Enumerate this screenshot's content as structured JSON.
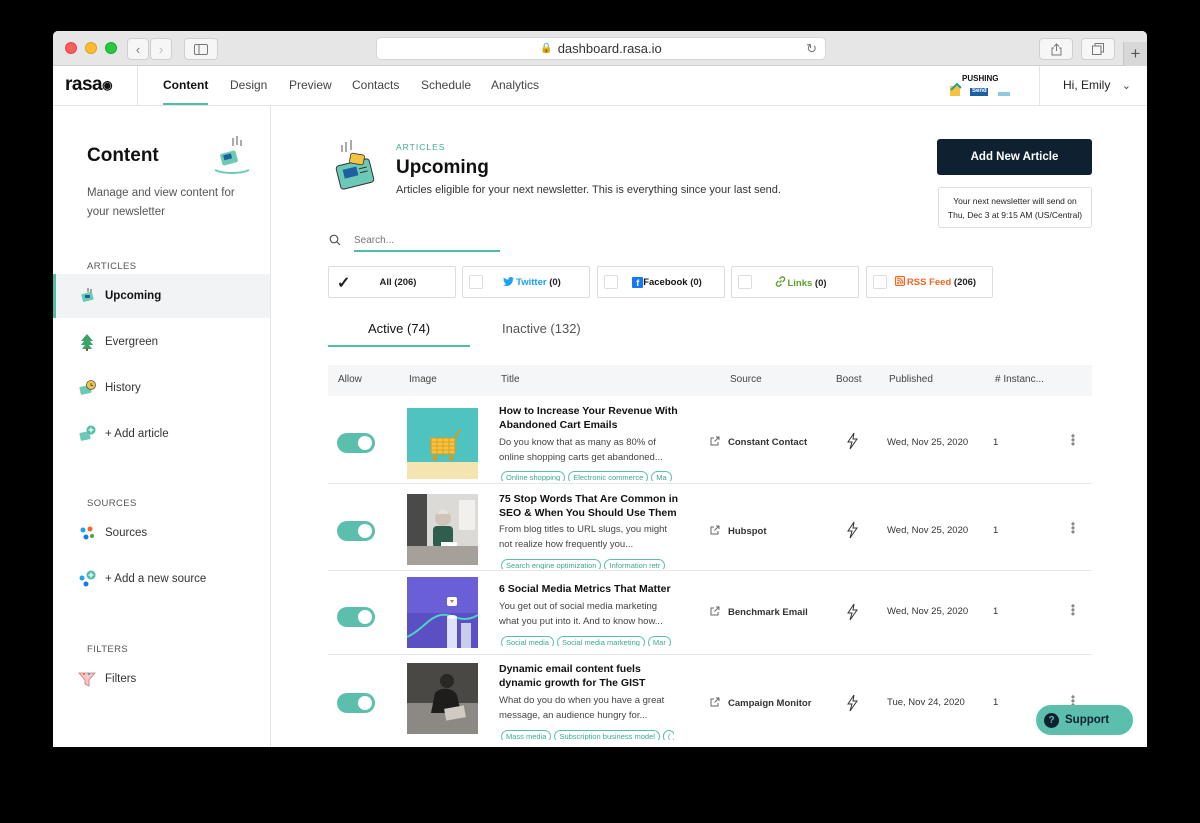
{
  "browser": {
    "url": "dashboard.rasa.io"
  },
  "nav": {
    "logo": "rasa",
    "tabs": [
      "Content",
      "Design",
      "Preview",
      "Contacts",
      "Schedule",
      "Analytics"
    ],
    "active_tab": "Content",
    "brand_label": "PUSHING",
    "brand_sub": "Send",
    "greeting": "Hi, Emily"
  },
  "sidebar": {
    "title": "Content",
    "description": "Manage and view content for your newsletter",
    "sections": {
      "articles": "ARTICLES",
      "sources": "SOURCES",
      "filters": "FILTERS"
    },
    "articles_items": [
      "Upcoming",
      "Evergreen",
      "History",
      "+ Add article"
    ],
    "sources_items": [
      "Sources",
      "+ Add a new source"
    ],
    "filters_items": [
      "Filters"
    ]
  },
  "header": {
    "label": "ARTICLES",
    "title": "Upcoming",
    "subtitle": "Articles eligible for your next newsletter. This is everything since your last send.",
    "add_button": "Add New Article",
    "next_send_line1": "Your next newsletter will send on",
    "next_send_line2": "Thu, Dec 3 at 9:15 AM (US/Central)"
  },
  "search": {
    "placeholder": "Search..."
  },
  "filters": {
    "all": {
      "label": "All (206)",
      "checked": true
    },
    "twitter": {
      "name": "Twitter",
      "count": "(0)",
      "color": "#1da1f2"
    },
    "facebook": {
      "name": "Facebook",
      "count": "(0)",
      "color": "#1877f2"
    },
    "links": {
      "name": "Links",
      "count": "(0)",
      "color": "#5aa02c"
    },
    "rss": {
      "name": "RSS Feed",
      "count": "(206)",
      "color": "#f26522"
    }
  },
  "tabs": {
    "active": "Active (74)",
    "inactive": "Inactive (132)"
  },
  "table": {
    "columns": [
      "Allow",
      "Image",
      "Title",
      "Source",
      "Boost",
      "Published",
      "# Instanc..."
    ],
    "rows": [
      {
        "title": "How to Increase Your Revenue With Abandoned Cart Emails",
        "desc": "Do you know that as many as 80% of online shopping carts get abandoned...",
        "tags": [
          "Online shopping",
          "Electronic commerce",
          "Ma"
        ],
        "source": "Constant Contact",
        "published": "Wed, Nov 25, 2020",
        "instances": "1",
        "allowed": true
      },
      {
        "title": "75 Stop Words That Are Common in SEO & When You Should Use Them",
        "desc": "From blog titles to URL slugs, you might not realize how frequently you...",
        "tags": [
          "Search engine optimization",
          "Information retr"
        ],
        "source": "Hubspot",
        "published": "Wed, Nov 25, 2020",
        "instances": "1",
        "allowed": true
      },
      {
        "title": "6 Social Media Metrics That Matter",
        "desc": "You get out of social media marketing what you put into it. And to know how...",
        "tags": [
          "Social media",
          "Social media marketing",
          "Mar"
        ],
        "source": "Benchmark Email",
        "published": "Wed, Nov 25, 2020",
        "instances": "1",
        "allowed": true
      },
      {
        "title": "Dynamic email content fuels dynamic growth for The GIST",
        "desc": "What do you do when you have a great message, an audience hungry for...",
        "tags": [
          "Mass media",
          "Subscription business model",
          "("
        ],
        "source": "Campaign Monitor",
        "published": "Tue, Nov 24, 2020",
        "instances": "1",
        "allowed": true
      }
    ]
  },
  "support": {
    "label": "Support"
  },
  "colors": {
    "accent": "#4cbfa6",
    "toggle": "#5cbfae",
    "dark_button": "#0f2130"
  }
}
